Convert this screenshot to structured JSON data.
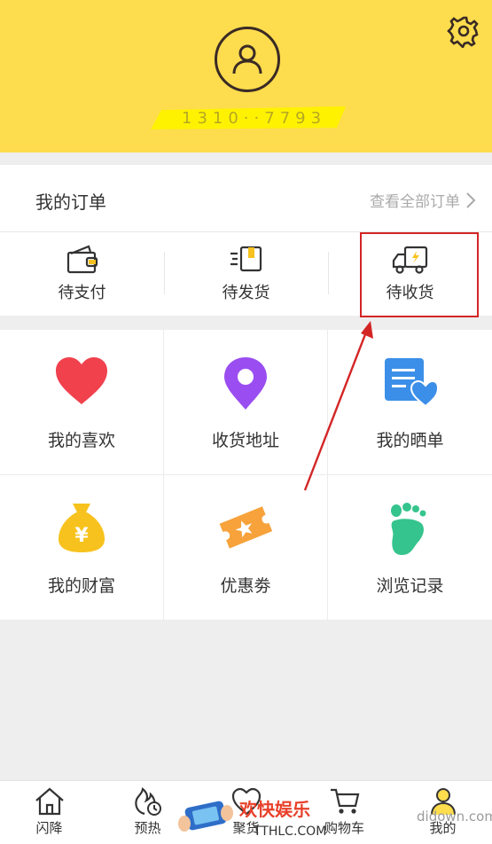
{
  "header": {
    "username_masked": "1310··7793",
    "bg_color": "#fddc4e",
    "avatar_icon": "user-icon",
    "settings_icon": "gear-icon"
  },
  "orders": {
    "title": "我的订单",
    "view_all": "查看全部订单",
    "items": [
      {
        "label": "待支付",
        "icon": "wallet-icon"
      },
      {
        "label": "待发货",
        "icon": "package-icon"
      },
      {
        "label": "待收货",
        "icon": "truck-icon"
      }
    ]
  },
  "grid": {
    "items": [
      {
        "label": "我的喜欢",
        "icon": "heart-icon"
      },
      {
        "label": "收货地址",
        "icon": "location-pin-icon"
      },
      {
        "label": "我的晒单",
        "icon": "review-note-icon"
      },
      {
        "label": "我的财富",
        "icon": "money-bag-icon"
      },
      {
        "label": "优惠劵",
        "icon": "coupon-icon"
      },
      {
        "label": "浏览记录",
        "icon": "footprint-icon"
      }
    ]
  },
  "tabbar": {
    "items": [
      {
        "label": "闪降",
        "icon": "home-icon"
      },
      {
        "label": "预热",
        "icon": "flame-clock-icon"
      },
      {
        "label": "聚货",
        "icon": "heart-outline-icon"
      },
      {
        "label": "购物车",
        "icon": "cart-icon"
      },
      {
        "label": "我的",
        "icon": "person-icon"
      }
    ]
  },
  "watermark": {
    "title": "欢快娱乐",
    "domain": "TTHLC.COM",
    "site": "didown.com"
  },
  "colors": {
    "accent_yellow": "#fddc4e",
    "highlight_red": "#d42525",
    "heart_red": "#f0414d",
    "pin_purple": "#9a4df0",
    "note_blue": "#3c8fe8",
    "bag_yellow": "#f7c21d",
    "coupon_orange": "#f7a23b",
    "foot_green": "#35c48d"
  }
}
